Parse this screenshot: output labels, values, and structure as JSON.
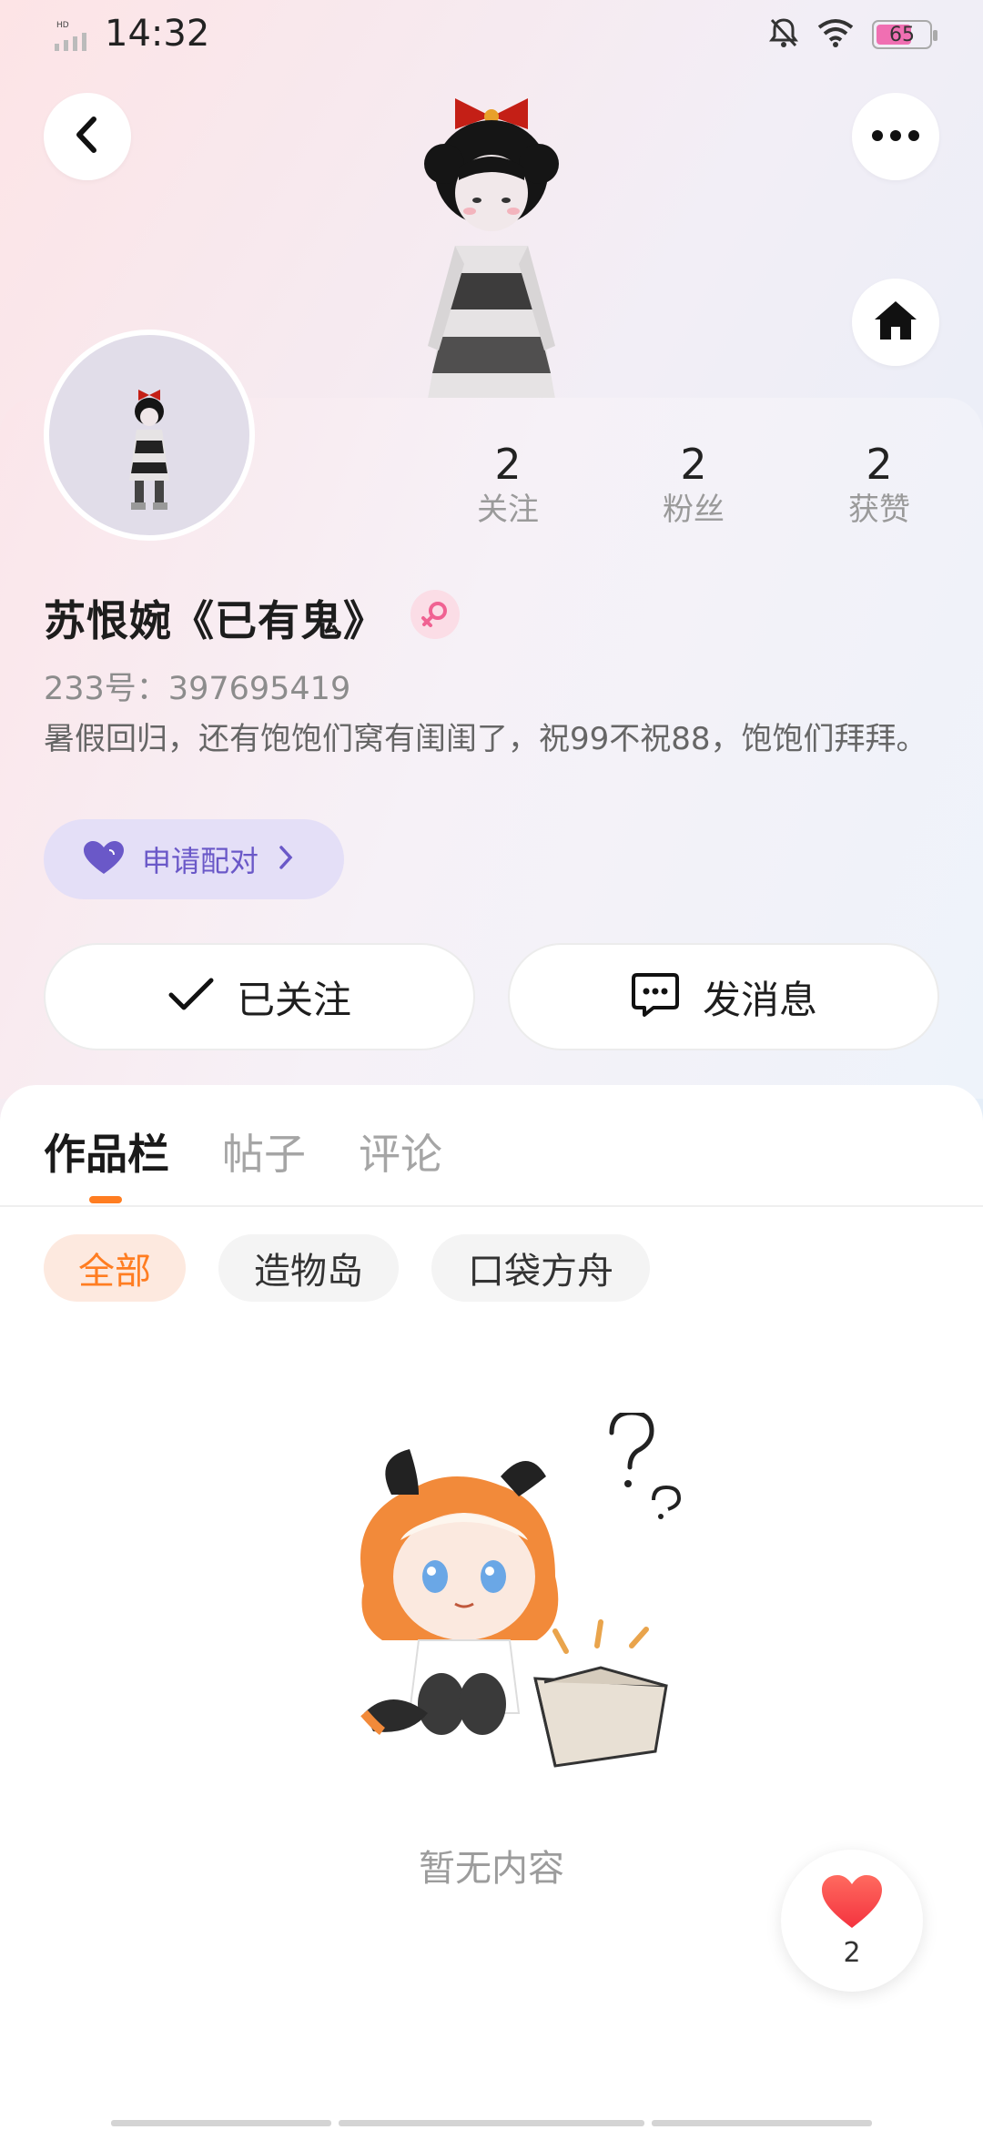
{
  "status_bar": {
    "time": "14:32",
    "battery": "65",
    "network_label": "HD"
  },
  "header": {
    "back_icon": "chevron-left-icon",
    "more_icon": "more-dots-icon",
    "home_icon": "home-icon"
  },
  "profile": {
    "stats": [
      {
        "count": "2",
        "label": "关注"
      },
      {
        "count": "2",
        "label": "粉丝"
      },
      {
        "count": "2",
        "label": "获赞"
      }
    ],
    "name": "苏恨婉《已有鬼》",
    "gender": "female",
    "uid": "233号：397695419",
    "bio": "暑假回归，还有饱饱们窝有闺闺了，祝99不祝88，饱饱们拜拜。",
    "pair_button": "申请配对",
    "follow_button": "已关注",
    "message_button": "发消息"
  },
  "tabs": [
    {
      "label": "作品栏",
      "active": true
    },
    {
      "label": "帖子",
      "active": false
    },
    {
      "label": "评论",
      "active": false
    }
  ],
  "filters": [
    {
      "label": "全部",
      "active": true
    },
    {
      "label": "造物岛",
      "active": false
    },
    {
      "label": "口袋方舟",
      "active": false
    }
  ],
  "empty_state": {
    "text": "暂无内容"
  },
  "like_float": {
    "count": "2"
  },
  "colors": {
    "accent": "#ff7d21",
    "pair_purple": "#6a58c8",
    "like_red": "#f4333f"
  }
}
